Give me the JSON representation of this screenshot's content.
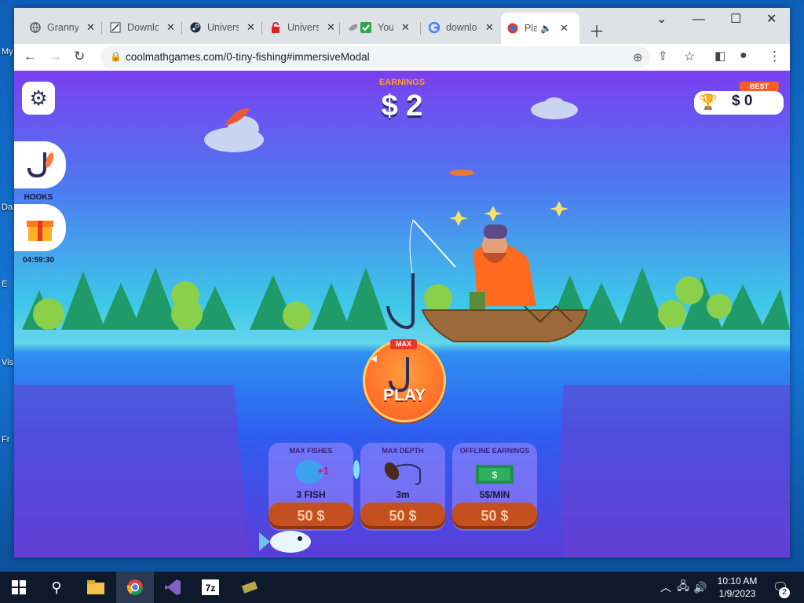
{
  "desktop": {
    "labels": [
      "My",
      "Da",
      "E",
      "Vis",
      "Fr"
    ]
  },
  "browser": {
    "tabs": [
      {
        "title": "Granny",
        "icon": "globe-icon"
      },
      {
        "title": "Downlo",
        "icon": "download-page-icon"
      },
      {
        "title": "Univers",
        "icon": "steam-icon"
      },
      {
        "title": "Univers",
        "icon": "lock-red-icon"
      },
      {
        "title": "You",
        "icon": "checkmark-green-icon"
      },
      {
        "title": "downlo",
        "icon": "google-icon"
      },
      {
        "title": "Pla",
        "icon": "coolmath-icon",
        "audio": true
      }
    ],
    "url": "coolmathgames.com/0-tiny-fishing#immersiveModal"
  },
  "game": {
    "earnings_label": "EARNINGS",
    "earnings_value": "$ 2",
    "best_tag": "BEST",
    "best_value": "$ 0",
    "hooks_label": "HOOKS",
    "gift_timer": "04:59:30",
    "play_label": "PLAY",
    "play_max": "MAX",
    "upgrades": [
      {
        "title": "MAX FISHES",
        "value": "3 FISH",
        "extra": "+1",
        "cost": "50 $"
      },
      {
        "title": "MAX DEPTH",
        "value": "3m",
        "cost": "50 $"
      },
      {
        "title": "OFFLINE EARNINGS",
        "value": "5$/MIN",
        "cost": "50 $"
      }
    ]
  },
  "taskbar": {
    "time": "10:10 AM",
    "date": "1/9/2023",
    "notifications": "2"
  }
}
